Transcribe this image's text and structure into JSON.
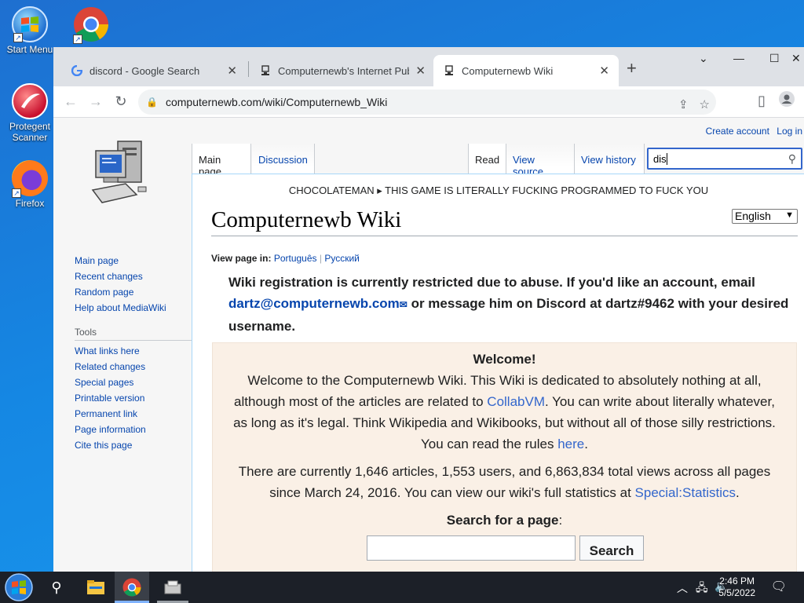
{
  "desktop": {
    "icons": [
      {
        "label": "Start Menu"
      },
      {
        "label": ""
      },
      {
        "label": "Protegent Scanner"
      },
      {
        "label": "Firefox"
      }
    ]
  },
  "browser": {
    "tabs": [
      {
        "title": "discord - Google Search",
        "favicon": "google-icon"
      },
      {
        "title": "Computernewb's Internet Pub H",
        "favicon": "computernewb-icon"
      },
      {
        "title": "Computernewb Wiki",
        "favicon": "computernewb-icon"
      }
    ],
    "active_tab": 2,
    "url": "computernewb.com/wiki/Computernewb_Wiki"
  },
  "wiki": {
    "personal": {
      "create_account": "Create account",
      "login": "Log in"
    },
    "tabs": {
      "main_page": "Main page",
      "discussion": "Discussion",
      "read": "Read",
      "view_source": "View source",
      "view_history": "View history"
    },
    "search_value": "dis",
    "sidebar": {
      "nav": [
        "Main page",
        "Recent changes",
        "Random page",
        "Help about MediaWiki"
      ],
      "tools_heading": "Tools",
      "tools": [
        "What links here",
        "Related changes",
        "Special pages",
        "Printable version",
        "Permanent link",
        "Page information",
        "Cite this page"
      ]
    },
    "sitenotice": "CHOCOLATEMAN ▸ THIS GAME IS LITERALLY FUCKING PROGRAMMED TO FUCK YOU",
    "title": "Computernewb Wiki",
    "language": "English",
    "view_page_in_label": "View page in:",
    "languages": [
      "Português",
      "Русский"
    ],
    "notice_part1": "Wiki registration is currently restricted due to abuse. If you'd like an account, email ",
    "notice_email": "dartz@computernewb.com",
    "notice_part2": " or message him on Discord at dartz#9462 with your desired username.",
    "welcome_heading": "Welcome!",
    "welcome_part1": "Welcome to the Computernewb Wiki. This Wiki is dedicated to absolutely nothing at all, although most of the articles are related to ",
    "welcome_link1": "CollabVM",
    "welcome_part2": ". You can write about literally whatever, as long as it's legal. Think Wikipedia and Wikibooks, but without all of those silly restrictions. You can read the rules ",
    "welcome_link2": "here",
    "welcome_part3": ".",
    "stats_part1": "There are currently 1,646 articles, 1,553 users, and 6,863,834 total views across all pages since March 24, 2016. You can view our wiki's full statistics at ",
    "stats_link": "Special:Statistics",
    "stats_part2": ".",
    "search_for_page": "Search for a page",
    "search_for_colon": ":",
    "search_button": "Search"
  },
  "taskbar": {
    "time": "2:46 PM",
    "date": "5/5/2022"
  }
}
